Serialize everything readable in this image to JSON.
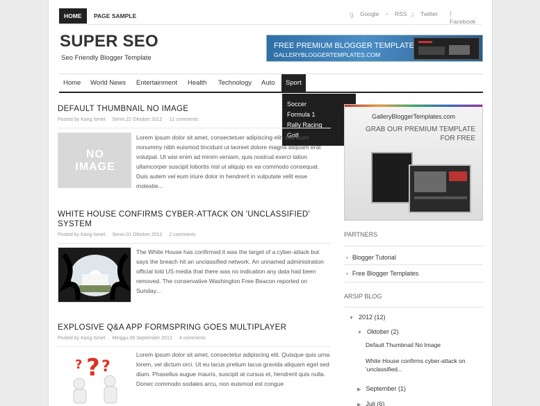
{
  "topnav": {
    "home": "HOME",
    "page_sample": "PAGE SAMPLE"
  },
  "social": {
    "google": "Google",
    "rss": "RSS",
    "twitter": "Twitter",
    "facebook": "Facebook"
  },
  "site": {
    "title": "SUPER SEO",
    "description": "Seo Friendly Blogger Template"
  },
  "banner": {
    "line1": "FREE PREMIUM BLOGGER TEMPLATES",
    "line2": "GALLERYBLOGGERTEMPLATES.COM"
  },
  "nav": {
    "items": [
      "Home",
      "World News",
      "Entertainment",
      "Health",
      "Technology",
      "Auto",
      "Sport"
    ],
    "active": "Sport",
    "dropdown": [
      "Soccer",
      "Formula 1",
      "Rally Racing",
      "Golf"
    ]
  },
  "posts": [
    {
      "title": "DEFAULT THUMBNAIL NO IMAGE",
      "author": "Posted by Kang Ismet",
      "date": "Senin,22 Oktober 2012",
      "comments": "12 comments",
      "thumb_text": "NO IMAGE",
      "excerpt": "Lorem ipsum dolor sit amet, consectetuer adipiscing elit, sed diam nonummy nibh euismod tincidunt ut laoreet dolore magna aliquam erat volutpat.  Ut wisi enim ad minim veniam, quis nostrud exerci tation ullamcorper suscipit lobortis nisl ut aliquip ex ea commodo consequat.  Duis autem vel eum iriure dolor in hendrerit in vulputate velit esse molestie..."
    },
    {
      "title": "WHITE HOUSE CONFIRMS CYBER-ATTACK ON 'UNCLASSIFIED' SYSTEM",
      "author": "Posted by Kang Ismet",
      "date": "Senin,01 Oktober 2012",
      "comments": "2 comments",
      "excerpt": "The White House has confirmed it was the target of a cyber-attack but says the breach hit an unclassified network. An unnamed administration official told US media that there was no indication any data had been removed. The conservative Washington Free Beacon reported on Sunday..."
    },
    {
      "title": "EXPLOSIVE Q&A APP FORMSPRING GOES MULTIPLAYER",
      "author": "Posted by Kang Ismet",
      "date": "Minggu,09 September 2012",
      "comments": "4 comments",
      "excerpt": "Lorem ipsum dolor sit amet, consectetur adipiscing elit. Quisque quis urna lorem, vel dictum orci. Ut eu lacus pretium lacus gravida aliquam eget sed diam. Phasellus augue mauris, suscipit at cursus et, hendrerit quis nulla. Donec commodo sodales arcu, non euismod est congue"
    }
  ],
  "promo": {
    "site": "GalleryBloggerTemplates.com",
    "line1": "GRAB OUR PREMIUM TEMPLATE",
    "line2": "FOR FREE"
  },
  "partners": {
    "heading": "PARTNERS",
    "links": [
      "Blogger Tutorial",
      "Free Blogger Templates"
    ]
  },
  "archive": {
    "heading": "ARSIP BLOG",
    "year": "2012",
    "year_count": "(12)",
    "month": "Oktober",
    "month_count": "(2)",
    "posts": [
      "Default Thumbnail No Image",
      "White House confirms cyber-attack on 'unclassified...",
      ""
    ],
    "september": "September",
    "september_count": "(1)",
    "juli": "Juli",
    "juli_count": "(6)"
  }
}
